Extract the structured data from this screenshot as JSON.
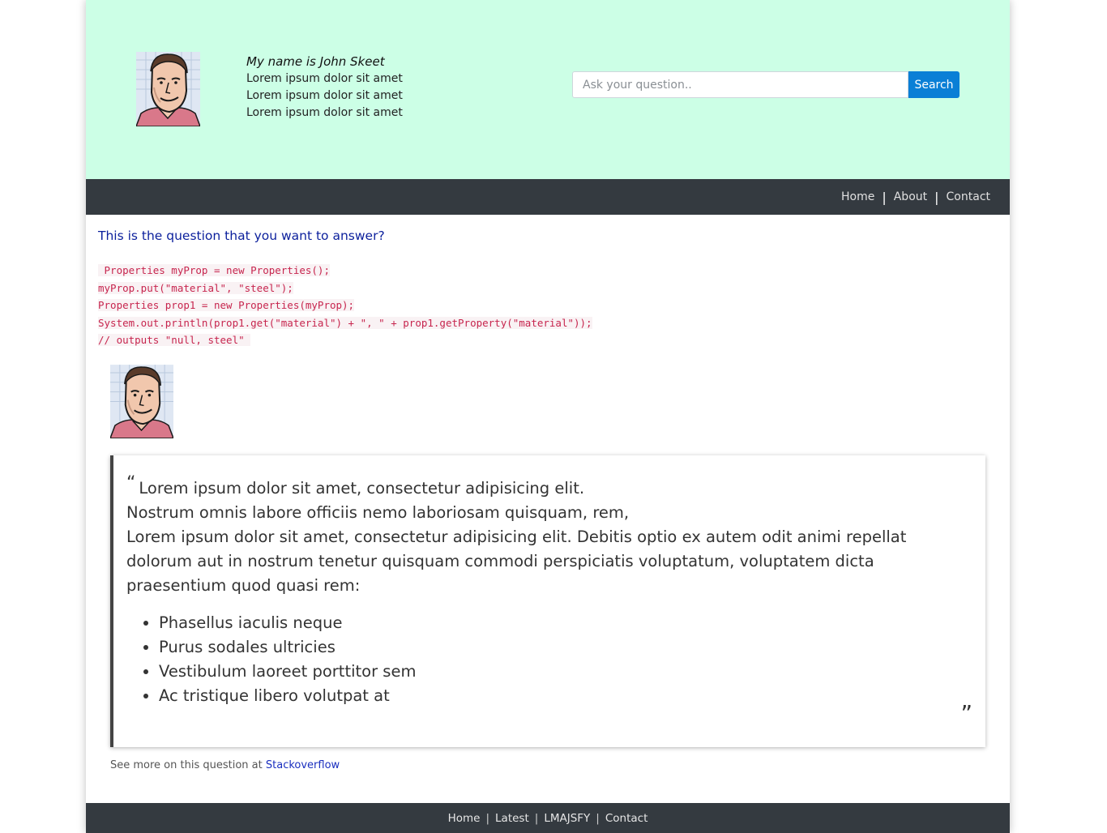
{
  "header": {
    "profile": {
      "name": "My name is John Skeet",
      "lines": [
        "Lorem ipsum dolor sit amet",
        "Lorem ipsum dolor sit amet",
        "Lorem ipsum dolor sit amet"
      ]
    },
    "search": {
      "placeholder": "Ask your question..",
      "button_label": "Search"
    },
    "background_color": "#ccffe6"
  },
  "nav": {
    "items": [
      {
        "label": "Home"
      },
      {
        "label": "About"
      },
      {
        "label": "Contact"
      }
    ],
    "separator": "|"
  },
  "question": {
    "title": "This is the question that you want to answer?",
    "code_lines": [
      " Properties myProp = new Properties();",
      "myProp.put(\"material\", \"steel\");",
      "Properties prop1 = new Properties(myProp);",
      "System.out.println(prop1.get(\"material\") + \", \" + prop1.getProperty(\"material\"));",
      "// outputs \"null, steel\" "
    ]
  },
  "answer": {
    "open_quote": "“",
    "close_quote": "”",
    "line1": "Lorem ipsum dolor sit amet, consectetur adipisicing elit.",
    "line2": "Nostrum omnis labore officiis nemo laboriosam quisquam, rem,",
    "line3": "Lorem ipsum dolor sit amet, consectetur adipisicing elit. Debitis optio ex autem odit animi repellat dolorum aut in nostrum tenetur quisquam commodi perspiciatis voluptatum, voluptatem dicta praesentium quod quasi rem:",
    "bullets": [
      "Phasellus iaculis neque",
      "Purus sodales ultricies",
      "Vestibulum laoreet porttitor sem",
      "Ac tristique libero volutpat at"
    ]
  },
  "see_more": {
    "prefix": "See more on this question at",
    "link_label": "Stackoverflow"
  },
  "footer": {
    "items": [
      {
        "label": "Home"
      },
      {
        "label": "Latest"
      },
      {
        "label": "LMAJSFY"
      },
      {
        "label": "Contact"
      }
    ],
    "separator": "|"
  },
  "colors": {
    "accent": "#0a7fd6",
    "nav_bg": "#343a40",
    "question_title": "#0b1f9c",
    "code_text": "#c7254e"
  }
}
